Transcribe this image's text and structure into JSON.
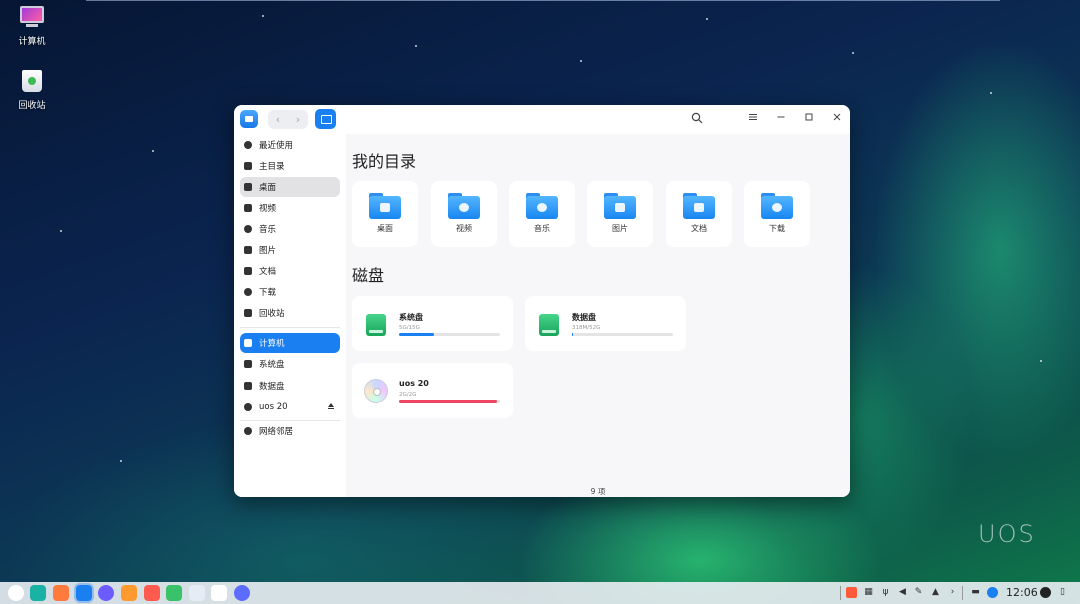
{
  "desktop": {
    "icons": [
      {
        "label": "计算机"
      },
      {
        "label": "回收站"
      }
    ],
    "watermark": "UOS"
  },
  "window": {
    "toolbar": {
      "back_glyph": "‹",
      "forward_glyph": "›",
      "icons": [
        "search-icon",
        "menu-icon",
        "minimize-icon",
        "maximize-icon",
        "close-icon"
      ]
    },
    "sidebar": {
      "items": [
        {
          "label": "最近使用",
          "icon": "clock-icon"
        },
        {
          "label": "主目录",
          "icon": "home-icon"
        },
        {
          "label": "桌面",
          "icon": "desktop-icon",
          "state": "hover"
        },
        {
          "label": "视频",
          "icon": "video-icon"
        },
        {
          "label": "音乐",
          "icon": "music-icon"
        },
        {
          "label": "图片",
          "icon": "picture-icon"
        },
        {
          "label": "文档",
          "icon": "document-icon"
        },
        {
          "label": "下载",
          "icon": "download-icon"
        },
        {
          "label": "回收站",
          "icon": "trash-icon"
        },
        {
          "label": "计算机",
          "icon": "computer-icon",
          "state": "active"
        },
        {
          "label": "系统盘",
          "icon": "disk-icon"
        },
        {
          "label": "数据盘",
          "icon": "disk-icon"
        },
        {
          "label": "uos 20",
          "icon": "cd-icon"
        },
        {
          "label": "网络邻居",
          "icon": "network-icon"
        }
      ]
    },
    "main": {
      "dirs_title": "我的目录",
      "dirs": [
        {
          "label": "桌面"
        },
        {
          "label": "视频"
        },
        {
          "label": "音乐"
        },
        {
          "label": "图片"
        },
        {
          "label": "文档"
        },
        {
          "label": "下载"
        }
      ],
      "disks_title": "磁盘",
      "disks": [
        {
          "name": "系统盘",
          "size": "5G/15G",
          "usage": 0.35,
          "color": "#1a7ff0"
        },
        {
          "name": "数据盘",
          "size": "318M/52G",
          "usage": 0.01,
          "color": "#1a7ff0"
        },
        {
          "name": "uos 20",
          "size": "2G/2G",
          "usage": 0.97,
          "color": "#ee4660"
        }
      ],
      "status": "9 项"
    }
  },
  "taskbar": {
    "time": "12:06",
    "accent": "#1a7ff0"
  }
}
